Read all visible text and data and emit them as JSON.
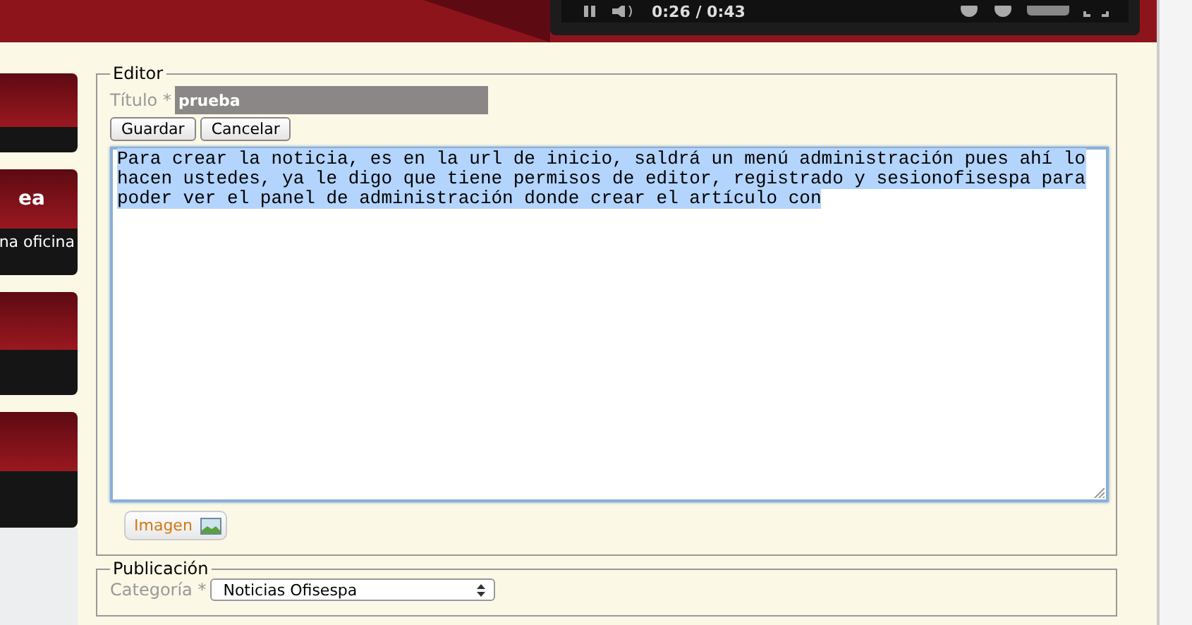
{
  "video_player": {
    "time": "0:26 / 0:43"
  },
  "sidebar": {
    "cards": [
      {
        "kind": "blank"
      },
      {
        "kind": "labeled",
        "title": "ea",
        "subtitle": "na oficina"
      },
      {
        "kind": "blank"
      },
      {
        "kind": "blank"
      }
    ]
  },
  "editor": {
    "legend": "Editor",
    "title_label": "Título *",
    "title_value": "prueba",
    "buttons": [
      "Guardar",
      "Cancelar"
    ],
    "body": "Para crear la noticia, es en la url de inicio, saldrá un menú administración pues ahí lo hacen ustedes, ya le digo que tiene permisos de editor, registrado y sesionofisespa para poder ver el panel de administración donde crear el artículo con",
    "body_selected": true,
    "image_button": "Imagen"
  },
  "publication": {
    "legend": "Publicación",
    "category_label": "Categoría *",
    "category_value": "Noticias Ofisespa"
  }
}
